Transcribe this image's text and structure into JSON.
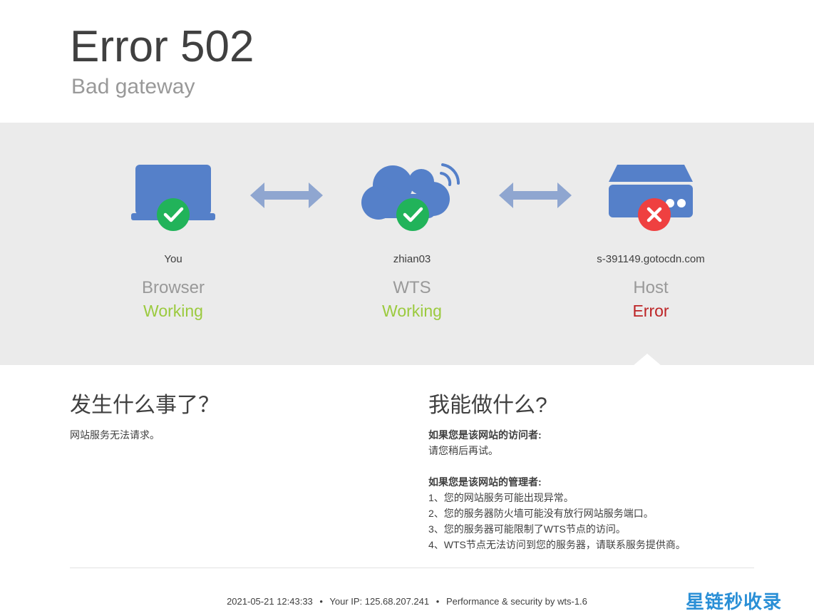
{
  "header": {
    "title": "Error 502",
    "subtitle": "Bad gateway"
  },
  "nodes": [
    {
      "name": "You",
      "role": "Browser",
      "state": "Working",
      "status": "ok",
      "icon": "laptop-icon"
    },
    {
      "name": "zhian03",
      "role": "WTS",
      "state": "Working",
      "status": "ok",
      "icon": "cloud-icon"
    },
    {
      "name": "s-391149.gotocdn.com",
      "role": "Host",
      "state": "Error",
      "status": "error",
      "icon": "server-icon"
    }
  ],
  "what_happened": {
    "heading": "发生什么事了？",
    "text": "网站服务无法请求。"
  },
  "what_to_do": {
    "heading": "我能做什么?",
    "visitor_title": "如果您是该网站的访问者:",
    "visitor_text": "请您稍后再试。",
    "admin_title": "如果您是该网站的管理者:",
    "admin_items": [
      "1、您的网站服务可能出现异常。",
      "2、您的服务器防火墙可能没有放行网站服务端口。",
      "3、您的服务器可能限制了WTS节点的访问。",
      "4、WTS节点无法访问到您的服务器，请联系服务提供商。"
    ]
  },
  "footer": {
    "timestamp": "2021-05-21 12:43:33",
    "ip": "Your IP: 125.68.207.241",
    "powered": "Performance & security by wts-1.6",
    "separator": "•"
  },
  "watermark": "星链秒收录",
  "colors": {
    "icon_blue": "#5580c9",
    "arrow": "#8fa6d0",
    "ok_green": "#21b35a",
    "error_red": "#ef4040",
    "working_text": "#9bca3e",
    "error_text": "#bd2426"
  }
}
